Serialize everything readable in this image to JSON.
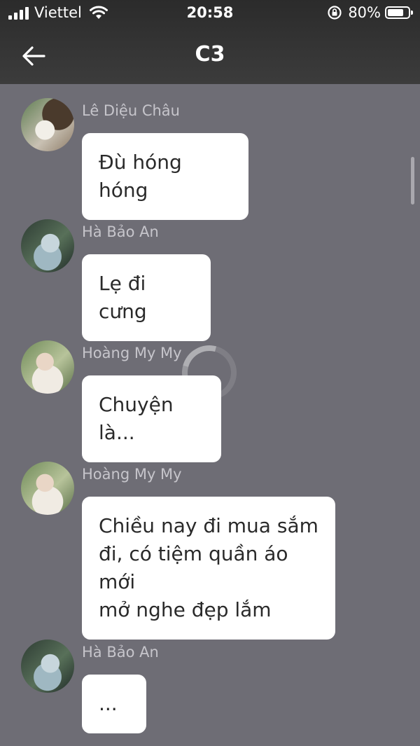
{
  "status_bar": {
    "carrier": "Viettel",
    "time": "20:58",
    "battery_percent": "80%",
    "battery_level": 0.8
  },
  "nav": {
    "title": "C3",
    "back_icon": "arrow-left-icon"
  },
  "messages": [
    {
      "sender": "Lê Diệu Châu",
      "text": "Đù hóng hóng"
    },
    {
      "sender": "Hà Bảo An",
      "text": "Lẹ đi cưng"
    },
    {
      "sender": "Hoàng My My",
      "text": "Chuyện là..."
    },
    {
      "sender": "Hoàng My My",
      "text": "Chiều nay đi mua sắm\nđi, có tiệm quần áo mới\nmở nghe đẹp lắm"
    },
    {
      "sender": "Hà Bảo An",
      "text": "..."
    }
  ],
  "colors": {
    "chat_background": "#6e6d75",
    "top_bar": "#333333",
    "bubble": "#ffffff",
    "sender_name": "#c6c5cb"
  }
}
